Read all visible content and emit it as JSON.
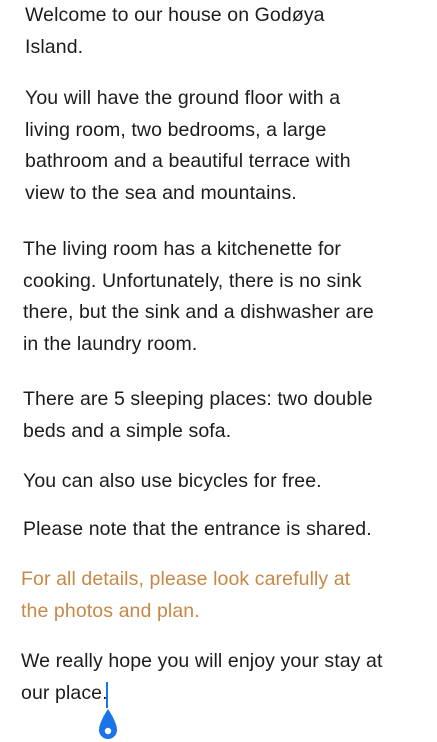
{
  "document": {
    "paragraphs": [
      {
        "lines": [
          "Welcome to our house on Godøya",
          "Island."
        ]
      },
      {
        "lines": [
          "You will have the ground floor with a",
          "living room, two bedrooms, a large",
          "bathroom and a beautiful terrace with",
          "view to the sea and mountains."
        ]
      },
      {
        "lines": [
          "The living room has a kitchenette for",
          "cooking. Unfortunately, there is no sink",
          "there, but the sink and a dishwasher are",
          "in the laundry room."
        ]
      },
      {
        "lines": [
          "There are 5 sleeping places: two double",
          "beds and a simple sofa."
        ]
      },
      {
        "lines": [
          "You can also use bicycles for free."
        ]
      },
      {
        "lines": [
          "Please note that the entrance is shared."
        ]
      },
      {
        "lines": [
          "For all details, please look carefully at",
          "the photos and plan."
        ]
      },
      {
        "lines": [
          "We really hope you will enjoy your stay at",
          "our place."
        ]
      }
    ]
  },
  "colors": {
    "text": "#1c1c1c",
    "accent_text": "#c98747",
    "cursor": "#1a73e8"
  },
  "icons": {
    "selection_handle": "teardrop-handle-icon"
  }
}
